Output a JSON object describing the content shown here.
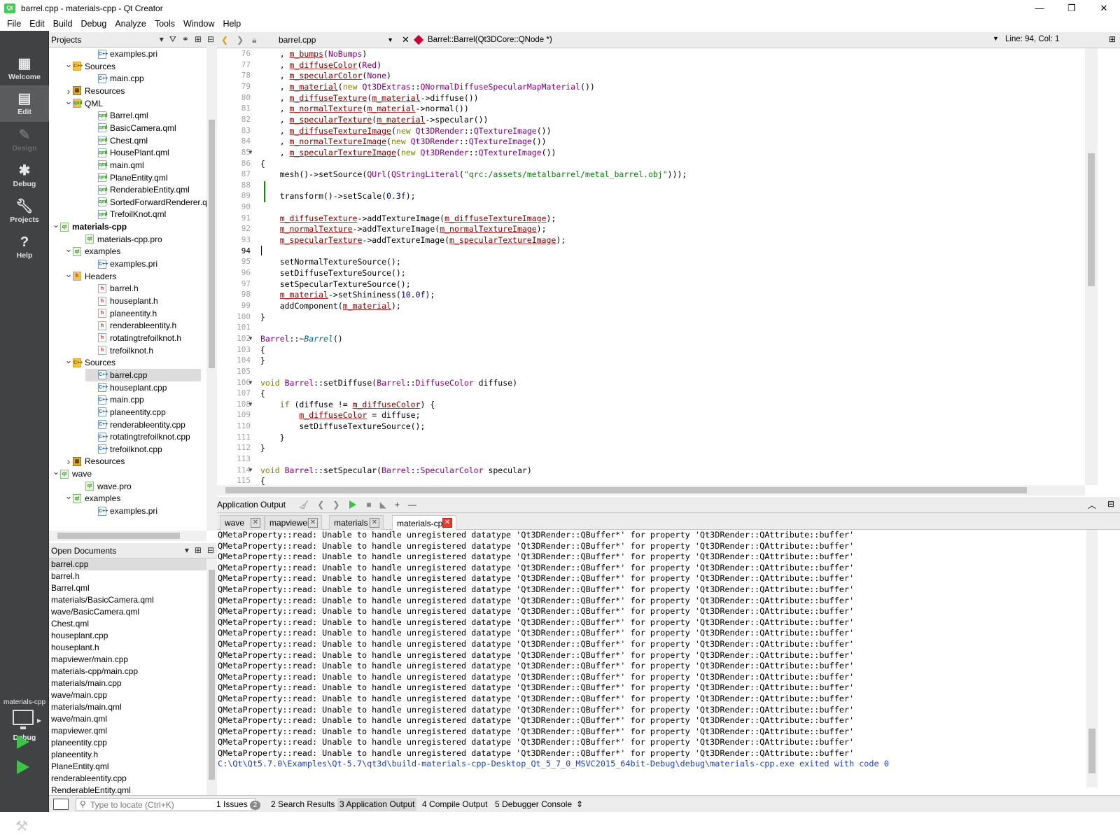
{
  "window": {
    "title": "barrel.cpp - materials-cpp - Qt Creator",
    "minimize": "—",
    "maximize": "❐",
    "close": "✕"
  },
  "menu": [
    "File",
    "Edit",
    "Build",
    "Debug",
    "Analyze",
    "Tools",
    "Window",
    "Help"
  ],
  "modes": [
    {
      "label": "Welcome",
      "icon": "grid-icon"
    },
    {
      "label": "Edit",
      "icon": "edit-icon"
    },
    {
      "label": "Design",
      "icon": "pen-icon"
    },
    {
      "label": "Debug",
      "icon": "bug-icon"
    },
    {
      "label": "Projects",
      "icon": "wrench-icon"
    },
    {
      "label": "Help",
      "icon": "help-icon"
    }
  ],
  "kit": {
    "project": "materials-cpp",
    "mode": "Debug"
  },
  "projects_panel": {
    "title": "Projects"
  },
  "tree": [
    {
      "d": 3,
      "icon": "pri",
      "label": "examples.pri"
    },
    {
      "d": 1,
      "arrow": "v",
      "icon": "src",
      "label": "Sources"
    },
    {
      "d": 3,
      "icon": "cpp",
      "label": "main.cpp"
    },
    {
      "d": 1,
      "arrow": ">",
      "icon": "lock",
      "label": "Resources"
    },
    {
      "d": 1,
      "arrow": "v",
      "icon": "qml",
      "label": "QML"
    },
    {
      "d": 3,
      "icon": "qml",
      "label": "Barrel.qml"
    },
    {
      "d": 3,
      "icon": "qml",
      "label": "BasicCamera.qml"
    },
    {
      "d": 3,
      "icon": "qml",
      "label": "Chest.qml"
    },
    {
      "d": 3,
      "icon": "qml",
      "label": "HousePlant.qml"
    },
    {
      "d": 3,
      "icon": "qml",
      "label": "main.qml"
    },
    {
      "d": 3,
      "icon": "qml",
      "label": "PlaneEntity.qml"
    },
    {
      "d": 3,
      "icon": "qml",
      "label": "RenderableEntity.qml"
    },
    {
      "d": 3,
      "icon": "qml",
      "label": "SortedForwardRenderer.qml"
    },
    {
      "d": 3,
      "icon": "qml",
      "label": "TrefoilKnot.qml"
    },
    {
      "d": 0,
      "arrow": "v",
      "icon": "pro",
      "label": "materials-cpp",
      "bold": true
    },
    {
      "d": 2,
      "icon": "pro",
      "label": "materials-cpp.pro"
    },
    {
      "d": 1,
      "arrow": "v",
      "icon": "pro",
      "label": "examples"
    },
    {
      "d": 3,
      "icon": "pri",
      "label": "examples.pri"
    },
    {
      "d": 1,
      "arrow": "v",
      "icon": "hdr",
      "label": "Headers"
    },
    {
      "d": 3,
      "icon": "h",
      "label": "barrel.h"
    },
    {
      "d": 3,
      "icon": "h",
      "label": "houseplant.h"
    },
    {
      "d": 3,
      "icon": "h",
      "label": "planeentity.h"
    },
    {
      "d": 3,
      "icon": "h",
      "label": "renderableentity.h"
    },
    {
      "d": 3,
      "icon": "h",
      "label": "rotatingtrefoilknot.h"
    },
    {
      "d": 3,
      "icon": "h",
      "label": "trefoilknot.h"
    },
    {
      "d": 1,
      "arrow": "v",
      "icon": "src",
      "label": "Sources"
    },
    {
      "d": 3,
      "icon": "cpp",
      "label": "barrel.cpp",
      "selected": true
    },
    {
      "d": 3,
      "icon": "cpp",
      "label": "houseplant.cpp"
    },
    {
      "d": 3,
      "icon": "cpp",
      "label": "main.cpp"
    },
    {
      "d": 3,
      "icon": "cpp",
      "label": "planeentity.cpp"
    },
    {
      "d": 3,
      "icon": "cpp",
      "label": "renderableentity.cpp"
    },
    {
      "d": 3,
      "icon": "cpp",
      "label": "rotatingtrefoilknot.cpp"
    },
    {
      "d": 3,
      "icon": "cpp",
      "label": "trefoilknot.cpp"
    },
    {
      "d": 1,
      "arrow": ">",
      "icon": "lock",
      "label": "Resources"
    },
    {
      "d": 0,
      "arrow": "v",
      "icon": "pro",
      "label": "wave"
    },
    {
      "d": 2,
      "icon": "pro",
      "label": "wave.pro"
    },
    {
      "d": 1,
      "arrow": "v",
      "icon": "pro",
      "label": "examples"
    },
    {
      "d": 3,
      "icon": "pri",
      "label": "examples.pri"
    }
  ],
  "open_documents_panel": {
    "title": "Open Documents"
  },
  "open_documents": [
    "barrel.cpp",
    "barrel.h",
    "Barrel.qml",
    "materials/BasicCamera.qml",
    "wave/BasicCamera.qml",
    "Chest.qml",
    "houseplant.cpp",
    "houseplant.h",
    "mapviewer/main.cpp",
    "materials-cpp/main.cpp",
    "materials/main.cpp",
    "wave/main.cpp",
    "materials/main.qml",
    "wave/main.qml",
    "mapviewer.qml",
    "planeentity.cpp",
    "planeentity.h",
    "PlaneEntity.qml",
    "renderableentity.cpp",
    "RenderableEntity.qml"
  ],
  "editor": {
    "file": "barrel.cpp",
    "symbol": "Barrel::Barrel(Qt3DCore::QNode *)",
    "position": "Line: 94, Col: 1",
    "first_line": 76,
    "current_line": 94,
    "fold_lines": [
      85,
      102,
      106,
      108,
      114
    ],
    "code": [
      [
        [
          "    , "
        ],
        [
          "m_bumps",
          "mem"
        ],
        [
          "("
        ],
        [
          "NoBumps",
          "ty"
        ],
        [
          ")"
        ]
      ],
      [
        [
          "    , "
        ],
        [
          "m_diffuseColor",
          "mem"
        ],
        [
          "("
        ],
        [
          "Red",
          "ty"
        ],
        [
          ")"
        ]
      ],
      [
        [
          "    , "
        ],
        [
          "m_specularColor",
          "mem"
        ],
        [
          "("
        ],
        [
          "None",
          "ty"
        ],
        [
          ")"
        ]
      ],
      [
        [
          "    , "
        ],
        [
          "m_material",
          "mem"
        ],
        [
          "("
        ],
        [
          "new ",
          "kw"
        ],
        [
          "Qt3DExtras",
          "ty"
        ],
        [
          "::"
        ],
        [
          "QNormalDiffuseSpecularMapMaterial",
          "ty"
        ],
        [
          "())"
        ]
      ],
      [
        [
          "    , "
        ],
        [
          "m_diffuseTexture",
          "mem"
        ],
        [
          "("
        ],
        [
          "m_material",
          "mem"
        ],
        [
          "->diffuse())"
        ]
      ],
      [
        [
          "    , "
        ],
        [
          "m_normalTexture",
          "mem"
        ],
        [
          "("
        ],
        [
          "m_material",
          "mem"
        ],
        [
          "->normal())"
        ]
      ],
      [
        [
          "    , "
        ],
        [
          "m_specularTexture",
          "mem"
        ],
        [
          "("
        ],
        [
          "m_material",
          "mem"
        ],
        [
          "->specular())"
        ]
      ],
      [
        [
          "    , "
        ],
        [
          "m_diffuseTextureImage",
          "mem"
        ],
        [
          "("
        ],
        [
          "new ",
          "kw"
        ],
        [
          "Qt3DRender",
          "ty"
        ],
        [
          "::"
        ],
        [
          "QTextureImage",
          "ty"
        ],
        [
          "())"
        ]
      ],
      [
        [
          "    , "
        ],
        [
          "m_normalTextureImage",
          "mem"
        ],
        [
          "("
        ],
        [
          "new ",
          "kw"
        ],
        [
          "Qt3DRender",
          "ty"
        ],
        [
          "::"
        ],
        [
          "QTextureImage",
          "ty"
        ],
        [
          "())"
        ]
      ],
      [
        [
          "    , "
        ],
        [
          "m_specularTextureImage",
          "mem"
        ],
        [
          "("
        ],
        [
          "new ",
          "kw"
        ],
        [
          "Qt3DRender",
          "ty"
        ],
        [
          "::"
        ],
        [
          "QTextureImage",
          "ty"
        ],
        [
          "())"
        ]
      ],
      [
        [
          "{"
        ]
      ],
      [
        [
          "    mesh()->setSource("
        ],
        [
          "QUrl",
          "ty"
        ],
        [
          "("
        ],
        [
          "QStringLiteral",
          "ty"
        ],
        [
          "("
        ],
        [
          "\"qrc:/assets/metalbarrel/metal_barrel.obj\"",
          "str"
        ],
        [
          ")));"
        ]
      ],
      [
        [
          ""
        ]
      ],
      [
        [
          "    transform()->setScale("
        ],
        [
          "0.3f",
          "num"
        ],
        [
          ");"
        ]
      ],
      [
        [
          ""
        ]
      ],
      [
        [
          "    "
        ],
        [
          "m_diffuseTexture",
          "mem"
        ],
        [
          "->addTextureImage("
        ],
        [
          "m_diffuseTextureImage",
          "mem"
        ],
        [
          ");"
        ]
      ],
      [
        [
          "    "
        ],
        [
          "m_normalTexture",
          "mem"
        ],
        [
          "->addTextureImage("
        ],
        [
          "m_normalTextureImage",
          "mem"
        ],
        [
          ");"
        ]
      ],
      [
        [
          "    "
        ],
        [
          "m_specularTexture",
          "mem"
        ],
        [
          "->addTextureImage("
        ],
        [
          "m_specularTextureImage",
          "mem"
        ],
        [
          ");"
        ]
      ],
      [
        [
          ""
        ]
      ],
      [
        [
          "    setNormalTextureSource();"
        ]
      ],
      [
        [
          "    setDiffuseTextureSource();"
        ]
      ],
      [
        [
          "    setSpecularTextureSource();"
        ]
      ],
      [
        [
          "    "
        ],
        [
          "m_material",
          "mem"
        ],
        [
          "->setShininess("
        ],
        [
          "10.0f",
          "num"
        ],
        [
          ");"
        ]
      ],
      [
        [
          "    addComponent("
        ],
        [
          "m_material",
          "mem"
        ],
        [
          ");"
        ]
      ],
      [
        [
          "}"
        ]
      ],
      [
        [
          ""
        ]
      ],
      [
        [
          "Barrel",
          "ty"
        ],
        [
          "::~"
        ],
        [
          "Barrel",
          "fn it"
        ],
        [
          "()"
        ]
      ],
      [
        [
          "{"
        ]
      ],
      [
        [
          "}"
        ]
      ],
      [
        [
          ""
        ]
      ],
      [
        [
          "void ",
          "kw"
        ],
        [
          "Barrel",
          "ty"
        ],
        [
          "::setDiffuse("
        ],
        [
          "Barrel",
          "ty"
        ],
        [
          "::"
        ],
        [
          "DiffuseColor",
          "ty"
        ],
        [
          " diffuse)"
        ]
      ],
      [
        [
          "{"
        ]
      ],
      [
        [
          "    "
        ],
        [
          "if ",
          "kw"
        ],
        [
          "(diffuse != "
        ],
        [
          "m_diffuseColor",
          "mem"
        ],
        [
          ") {"
        ]
      ],
      [
        [
          "        "
        ],
        [
          "m_diffuseColor",
          "mem"
        ],
        [
          " = diffuse;"
        ]
      ],
      [
        [
          "        setDiffuseTextureSource();"
        ]
      ],
      [
        [
          "    }"
        ]
      ],
      [
        [
          "}"
        ]
      ],
      [
        [
          ""
        ]
      ],
      [
        [
          "void ",
          "kw"
        ],
        [
          "Barrel",
          "ty"
        ],
        [
          "::setSpecular("
        ],
        [
          "Barrel",
          "ty"
        ],
        [
          "::"
        ],
        [
          "SpecularColor",
          "ty"
        ],
        [
          " specular)"
        ]
      ],
      [
        [
          "{"
        ]
      ]
    ]
  },
  "output": {
    "title": "Application Output",
    "tabs": [
      "wave",
      "mapviewer",
      "materials",
      "materials-cpp"
    ],
    "active_tab": "materials-cpp",
    "warning": "QMetaProperty::read: Unable to handle unregistered datatype 'Qt3DRender::QBuffer*' for property 'Qt3DRender::QAttribute::buffer'",
    "warning_count": 21,
    "exit_line": "C:\\Qt\\Qt5.7.0\\Examples\\Qt-5.7\\qt3d\\build-materials-cpp-Desktop_Qt_5_7_0_MSVC2015_64bit-Debug\\debug\\materials-cpp.exe exited with code 0"
  },
  "statusbar": {
    "locate_placeholder": "Type to locate (Ctrl+K)",
    "tabs": [
      {
        "num": "1",
        "label": "Issues",
        "badge": "2"
      },
      {
        "num": "2",
        "label": "Search Results"
      },
      {
        "num": "3",
        "label": "Application Output",
        "active": true
      },
      {
        "num": "4",
        "label": "Compile Output"
      },
      {
        "num": "5",
        "label": "Debugger Console"
      }
    ]
  },
  "colors": {
    "modebar": "#404244",
    "keyword": "#808000",
    "type": "#800080",
    "member": "#800000",
    "string": "#008000",
    "number": "#000080",
    "exit_text": "#1a3ec7"
  }
}
